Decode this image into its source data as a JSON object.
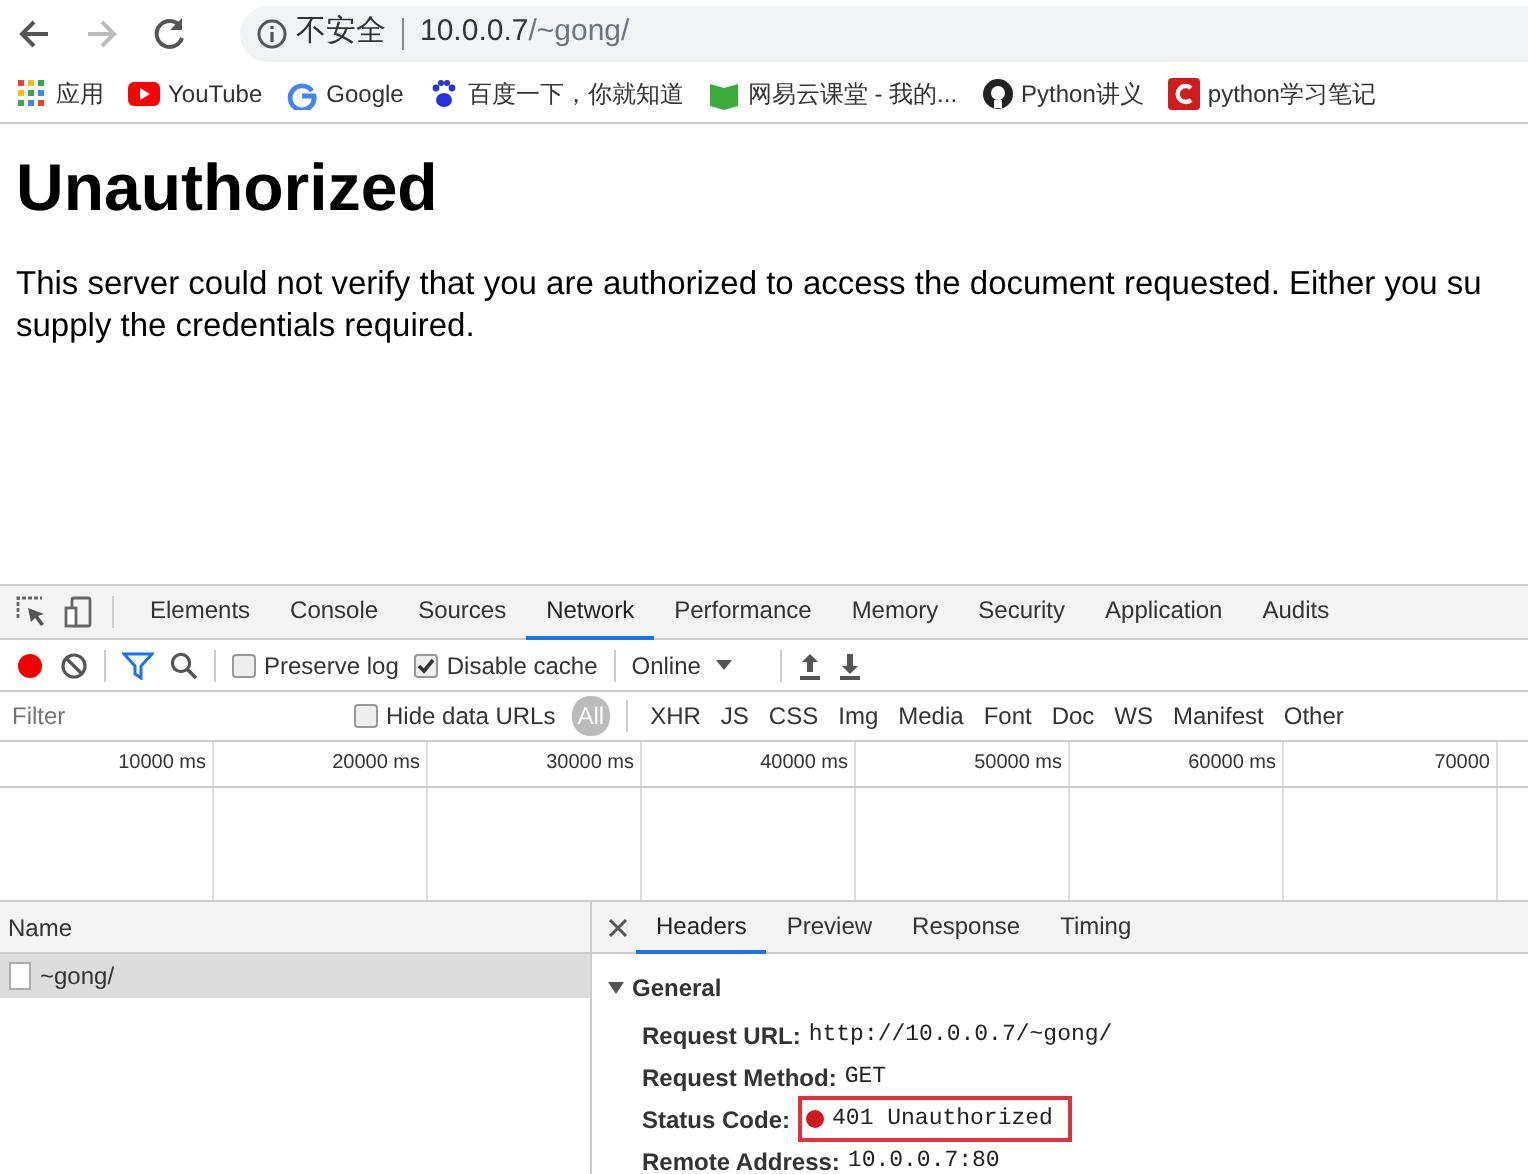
{
  "address_bar": {
    "back_enabled": true,
    "forward_enabled": false,
    "security_label": "不安全",
    "url_host": "10.0.0.7",
    "url_path": "/~gong/"
  },
  "bookmarks": [
    {
      "label": "应用",
      "kind": "apps"
    },
    {
      "label": "YouTube",
      "kind": "youtube"
    },
    {
      "label": "Google",
      "kind": "google"
    },
    {
      "label": "百度一下，你就知道",
      "kind": "baidu"
    },
    {
      "label": "网易云课堂 - 我的...",
      "kind": "book"
    },
    {
      "label": "Python讲义",
      "kind": "github"
    },
    {
      "label": "python学习笔记",
      "kind": "red"
    }
  ],
  "page": {
    "heading": "Unauthorized",
    "paragraph": "This server could not verify that you are authorized to access the document requested. Either you su\nsupply the credentials required."
  },
  "devtools": {
    "tabs": [
      {
        "label": "Elements",
        "selected": false
      },
      {
        "label": "Console",
        "selected": false
      },
      {
        "label": "Sources",
        "selected": false
      },
      {
        "label": "Network",
        "selected": true
      },
      {
        "label": "Performance",
        "selected": false
      },
      {
        "label": "Memory",
        "selected": false
      },
      {
        "label": "Security",
        "selected": false
      },
      {
        "label": "Application",
        "selected": false
      },
      {
        "label": "Audits",
        "selected": false
      }
    ],
    "toolbar": {
      "recording": true,
      "preserve_log": {
        "label": "Preserve log",
        "checked": false
      },
      "disable_cache": {
        "label": "Disable cache",
        "checked": true
      },
      "throttle": "Online"
    },
    "filter": {
      "placeholder": "Filter",
      "hide_data_urls": {
        "label": "Hide data URLs",
        "checked": false
      },
      "types": [
        {
          "label": "All",
          "selected": true
        },
        {
          "label": "XHR",
          "selected": false
        },
        {
          "label": "JS",
          "selected": false
        },
        {
          "label": "CSS",
          "selected": false
        },
        {
          "label": "Img",
          "selected": false
        },
        {
          "label": "Media",
          "selected": false
        },
        {
          "label": "Font",
          "selected": false
        },
        {
          "label": "Doc",
          "selected": false
        },
        {
          "label": "WS",
          "selected": false
        },
        {
          "label": "Manifest",
          "selected": false
        },
        {
          "label": "Other",
          "selected": false
        }
      ]
    },
    "timeline_ticks": [
      "10000 ms",
      "20000 ms",
      "30000 ms",
      "40000 ms",
      "50000 ms",
      "60000 ms",
      "70000"
    ],
    "requests_header": "Name",
    "requests": [
      {
        "name": "~gong/",
        "selected": true
      }
    ],
    "detail_tabs": [
      {
        "label": "Headers",
        "selected": true
      },
      {
        "label": "Preview",
        "selected": false
      },
      {
        "label": "Response",
        "selected": false
      },
      {
        "label": "Timing",
        "selected": false
      }
    ],
    "general": {
      "title": "General",
      "expanded": true,
      "rows": [
        {
          "label": "Request URL:",
          "value": "http://10.0.0.7/~gong/",
          "kind": "plain",
          "highlighted": false
        },
        {
          "label": "Request Method:",
          "value": "GET",
          "kind": "plain",
          "highlighted": false
        },
        {
          "label": "Status Code:",
          "value": "401 Unauthorized",
          "kind": "status",
          "highlighted": true
        },
        {
          "label": "Remote Address:",
          "value": "10.0.0.7:80",
          "kind": "plain",
          "highlighted": false
        }
      ]
    }
  }
}
